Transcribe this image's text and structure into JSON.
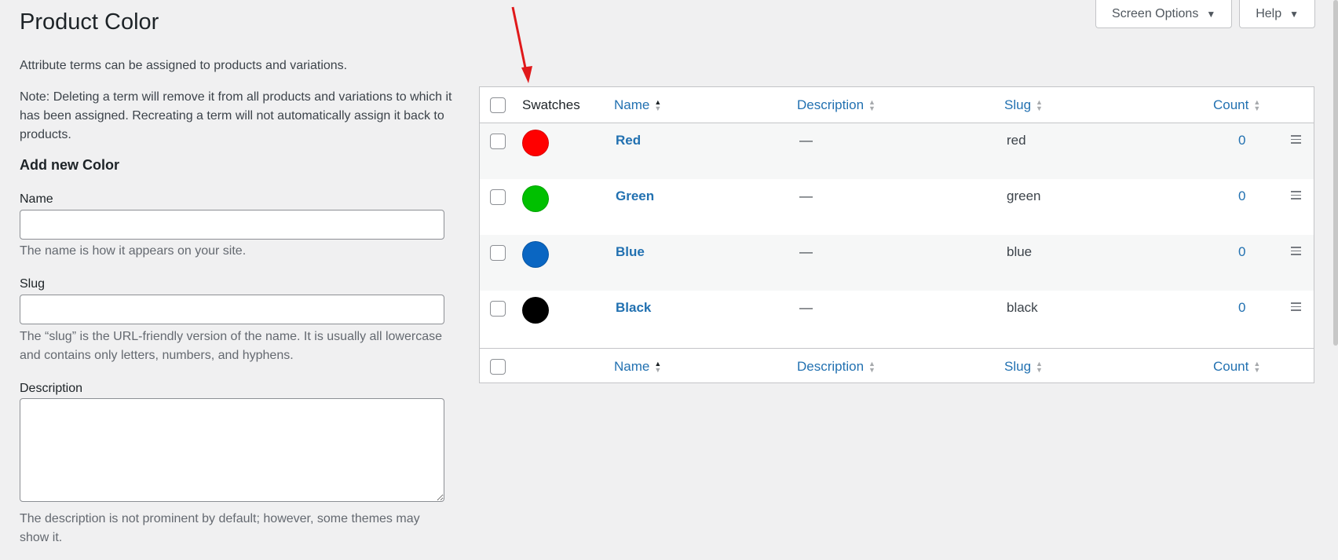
{
  "page": {
    "title": "Product Color"
  },
  "top_buttons": {
    "screen_options": "Screen Options",
    "help": "Help"
  },
  "left": {
    "intro": "Attribute terms can be assigned to products and variations.",
    "note": "Note: Deleting a term will remove it from all products and variations to which it has been assigned. Recreating a term will not automatically assign it back to products.",
    "add_title": "Add new Color",
    "name_label": "Name",
    "name_help": "The name is how it appears on your site.",
    "slug_label": "Slug",
    "slug_help": "The “slug” is the URL-friendly version of the name. It is usually all lowercase and contains only letters, numbers, and hyphens.",
    "description_label": "Description",
    "description_help": "The description is not prominent by default; however, some themes may show it."
  },
  "table": {
    "headers": {
      "swatches": "Swatches",
      "name": "Name",
      "description": "Description",
      "slug": "Slug",
      "count": "Count"
    },
    "rows": [
      {
        "name": "Red",
        "description": "—",
        "slug": "red",
        "count": "0",
        "color": "#ff0000"
      },
      {
        "name": "Green",
        "description": "—",
        "slug": "green",
        "count": "0",
        "color": "#00c000"
      },
      {
        "name": "Blue",
        "description": "—",
        "slug": "blue",
        "count": "0",
        "color": "#0a66c2"
      },
      {
        "name": "Black",
        "description": "—",
        "slug": "black",
        "count": "0",
        "color": "#000000"
      }
    ]
  },
  "colors": {
    "link": "#2271b1",
    "annotation_arrow": "#e0191b"
  }
}
